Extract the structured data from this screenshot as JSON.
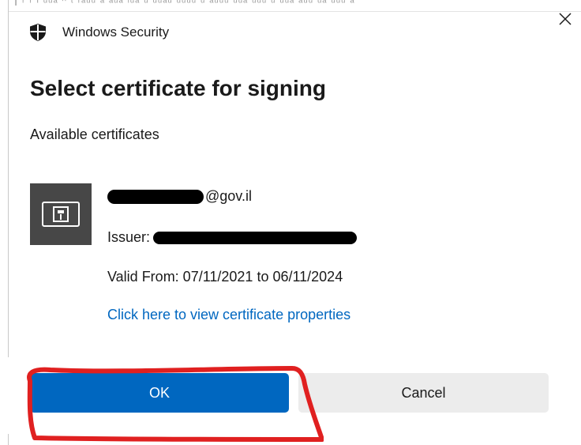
{
  "window": {
    "app_title": "Windows Security",
    "close_icon": "close-icon"
  },
  "dialog": {
    "heading": "Select certificate for signing",
    "subheading": "Available certificates"
  },
  "certificate": {
    "icon": "certificate-card-icon",
    "email_suffix": "@gov.il",
    "issuer_label": "Issuer:",
    "valid_from": "Valid From: 07/11/2021 to 06/11/2024",
    "properties_link": "Click here to view certificate properties"
  },
  "buttons": {
    "ok_label": "OK",
    "cancel_label": "Cancel"
  },
  "colors": {
    "accent": "#0067c0",
    "highlight_annotation": "#e02020"
  }
}
